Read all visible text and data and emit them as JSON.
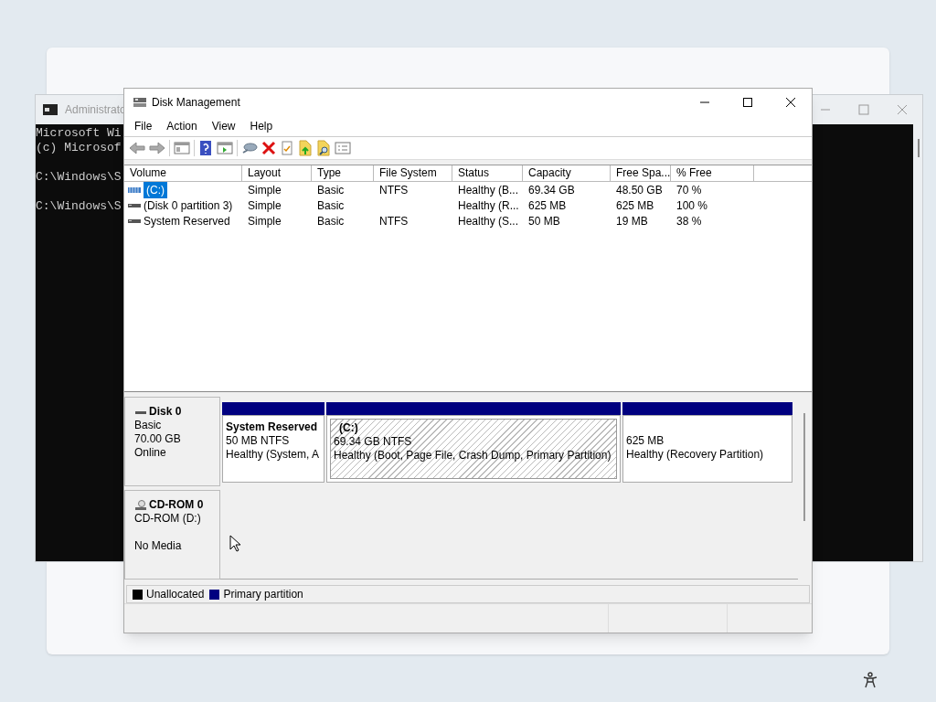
{
  "console_window": {
    "title": "Administrato",
    "blocks": [
      [
        "Microsoft Wi",
        "(c) Microsof"
      ],
      [
        "C:\\Windows\\S"
      ],
      [
        "C:\\Windows\\S"
      ]
    ]
  },
  "window": {
    "title": "Disk Management"
  },
  "menu": [
    "File",
    "Action",
    "View",
    "Help"
  ],
  "table": {
    "columns": [
      "Volume",
      "Layout",
      "Type",
      "File System",
      "Status",
      "Capacity",
      "Free Spa...",
      "% Free"
    ],
    "rows": [
      {
        "selected": true,
        "cells": [
          "(C:)",
          "Simple",
          "Basic",
          "NTFS",
          "Healthy (B...",
          "69.34 GB",
          "48.50 GB",
          "70 %"
        ]
      },
      {
        "selected": false,
        "cells": [
          "(Disk 0 partition 3)",
          "Simple",
          "Basic",
          "",
          "Healthy (R...",
          "625 MB",
          "625 MB",
          "100 %"
        ]
      },
      {
        "selected": false,
        "cells": [
          "System Reserved",
          "Simple",
          "Basic",
          "NTFS",
          "Healthy (S...",
          "50 MB",
          "19 MB",
          "38 %"
        ]
      }
    ]
  },
  "disks": [
    {
      "kind": "disk",
      "name": "Disk 0",
      "type": "Basic",
      "size": "70.00 GB",
      "status": "Online",
      "partitions": [
        {
          "title": "System Reserved",
          "lines": [
            "50 MB NTFS",
            "Healthy (System, A"
          ],
          "selected": false
        },
        {
          "title": "(C:)",
          "lines": [
            "69.34 GB NTFS",
            "Healthy (Boot, Page File, Crash Dump, Primary Partition)"
          ],
          "selected": true
        },
        {
          "lines": [
            "625 MB",
            "Healthy (Recovery Partition)"
          ],
          "selected": false
        }
      ]
    },
    {
      "kind": "cdrom",
      "name": "CD-ROM 0",
      "type": "CD-ROM (D:)",
      "status": "No Media"
    }
  ],
  "legend": [
    {
      "label": "Unallocated",
      "color": "#000000"
    },
    {
      "label": "Primary partition",
      "color": "#000080"
    }
  ]
}
